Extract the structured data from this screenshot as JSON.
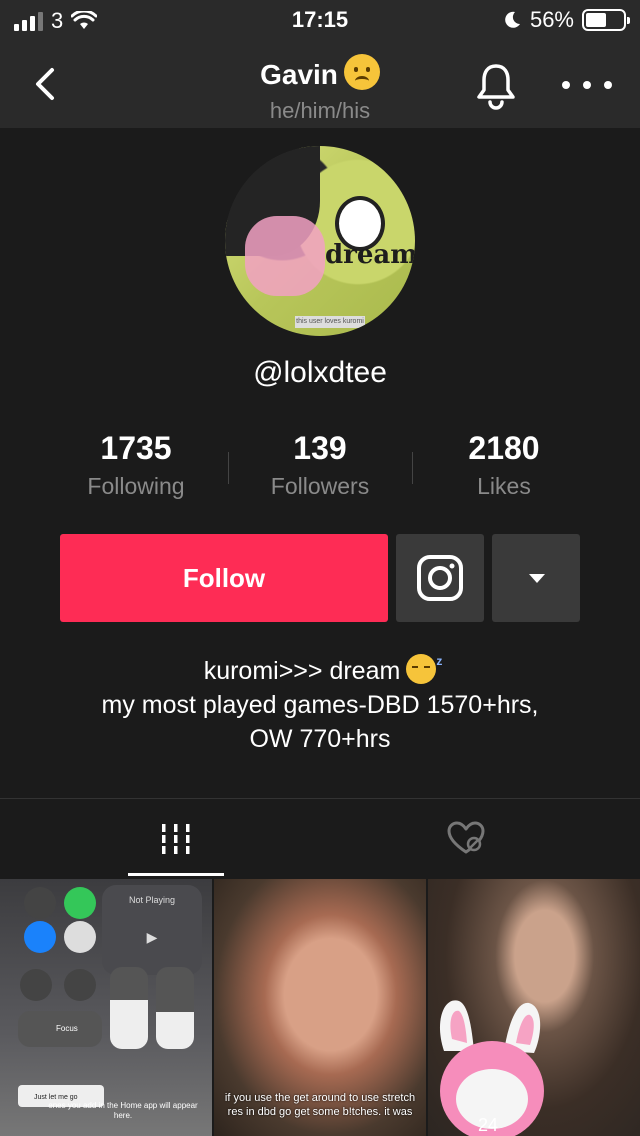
{
  "status_bar": {
    "carrier": "3",
    "time": "17:15",
    "battery": "56%",
    "battery_level": 0.56
  },
  "nav": {
    "title": "Gavin",
    "pronouns": "he/him/his"
  },
  "profile": {
    "handle": "@lolxdtee",
    "avatar_text": "dream",
    "avatar_caption": "this user loves kuromi",
    "stats": [
      {
        "value": "1735",
        "label": "Following"
      },
      {
        "value": "139",
        "label": "Followers"
      },
      {
        "value": "2180",
        "label": "Likes"
      }
    ],
    "follow_label": "Follow",
    "bio": [
      "kuromi>>> dream",
      "my most played games-DBD 1570+hrs,",
      "OW 770+hrs"
    ]
  },
  "videos": [
    {
      "caption": "Not Playing",
      "extra": "Just let me go",
      "extra2": "enes you add in the Home app will appear here.",
      "focus": "Focus"
    },
    {
      "caption": "if you use the get around to use stretch res in dbd go get some b!tches. it was"
    },
    {
      "caption": "24"
    }
  ],
  "colors": {
    "accent": "#fe2c55",
    "background": "#1b1b1b",
    "header": "#2a2a2a"
  },
  "icons": [
    "back-icon",
    "worried-emoji-icon",
    "bell-icon",
    "more-icon",
    "instagram-icon",
    "chevron-down-icon",
    "grid-icon",
    "liked-hidden-icon",
    "sleepy-emoji-icon"
  ]
}
